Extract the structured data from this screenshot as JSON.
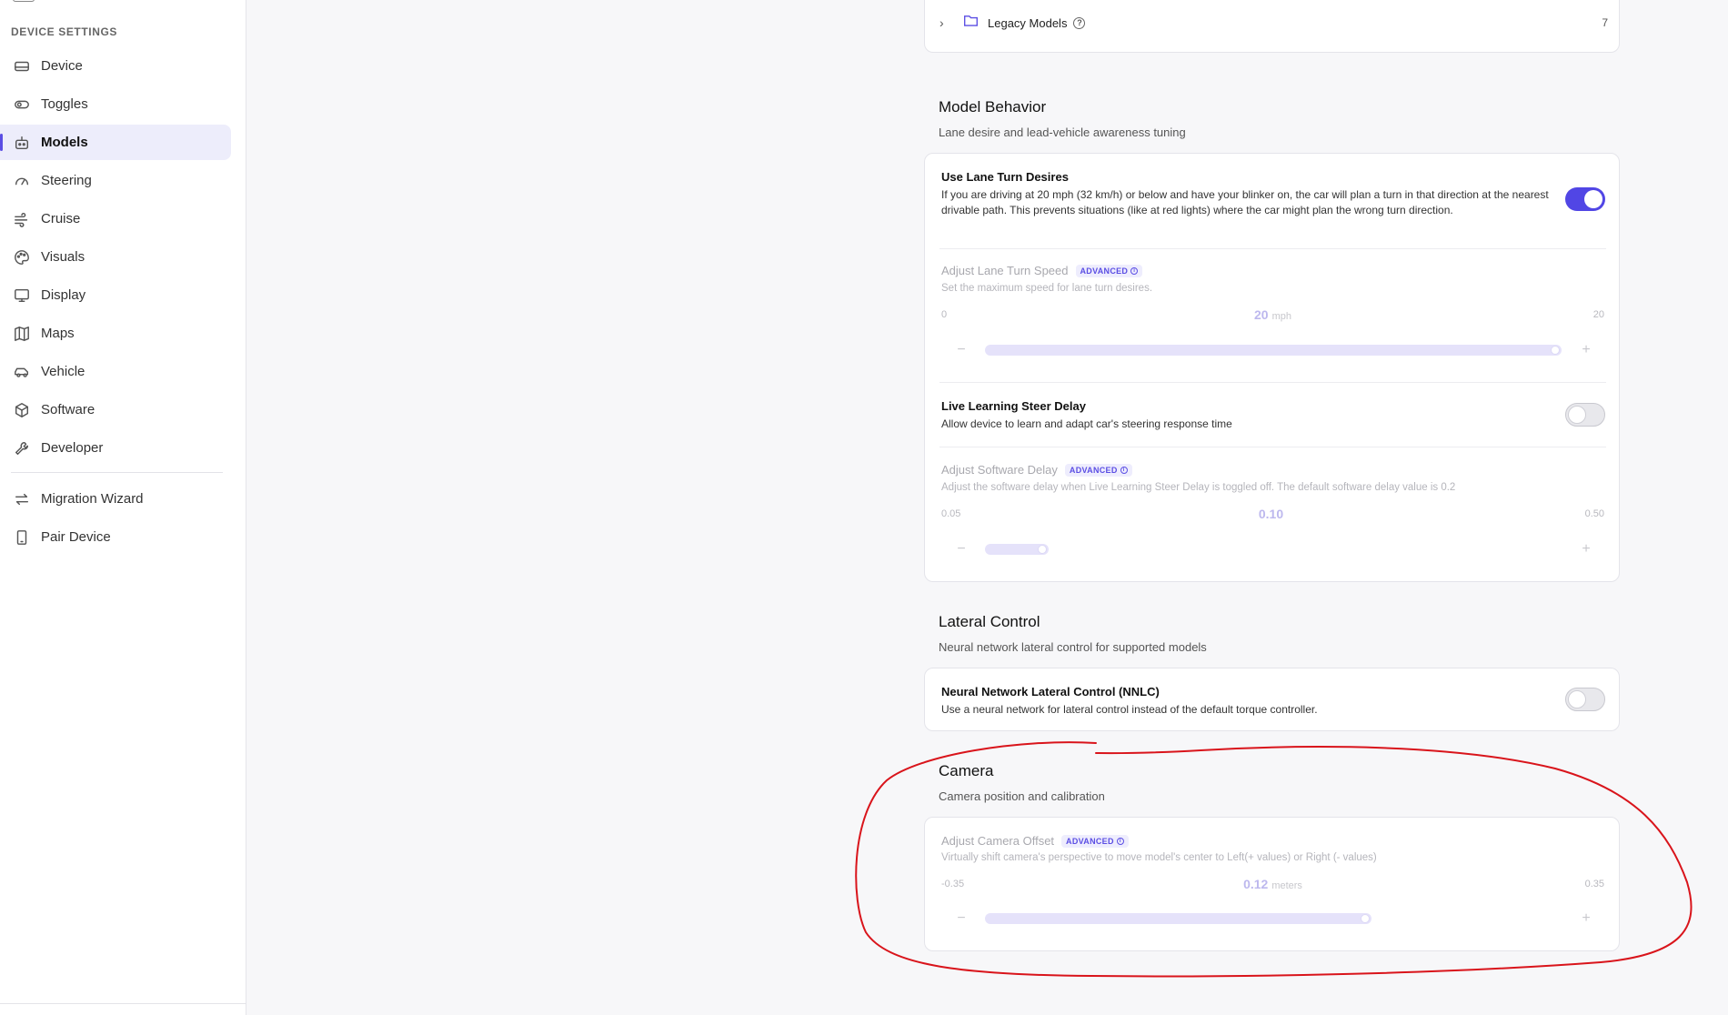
{
  "sidebar": {
    "section_label": "DEVICE SETTINGS",
    "items": [
      {
        "label": "Device",
        "icon": "device-icon"
      },
      {
        "label": "Toggles",
        "icon": "toggle-icon"
      },
      {
        "label": "Models",
        "icon": "robot-icon",
        "active": true
      },
      {
        "label": "Steering",
        "icon": "gauge-icon"
      },
      {
        "label": "Cruise",
        "icon": "wind-icon"
      },
      {
        "label": "Visuals",
        "icon": "palette-icon"
      },
      {
        "label": "Display",
        "icon": "monitor-icon"
      },
      {
        "label": "Maps",
        "icon": "map-icon"
      },
      {
        "label": "Vehicle",
        "icon": "car-icon"
      },
      {
        "label": "Software",
        "icon": "package-icon"
      },
      {
        "label": "Developer",
        "icon": "wrench-icon"
      }
    ],
    "extra_items": [
      {
        "label": "Migration Wizard",
        "icon": "arrows-icon"
      },
      {
        "label": "Pair Device",
        "icon": "tablet-icon"
      }
    ]
  },
  "legacy": {
    "label": "Legacy Models",
    "count": "7"
  },
  "model_behavior": {
    "title": "Model Behavior",
    "subtitle": "Lane desire and lead-vehicle awareness tuning",
    "lane_turn": {
      "title": "Use Lane Turn Desires",
      "desc": "If you are driving at 20 mph (32 km/h) or below and have your blinker on, the car will plan a turn in that direction at the nearest drivable path. This prevents situations (like at red lights) where the car might plan the wrong turn direction.",
      "enabled": true
    },
    "lane_turn_speed": {
      "title": "Adjust Lane Turn Speed",
      "badge": "ADVANCED",
      "desc": "Set the maximum speed for lane turn desires.",
      "min": "0",
      "max": "20",
      "value": "20",
      "unit": "mph",
      "fraction": 1.0,
      "minus": "−",
      "plus": "+"
    },
    "live_learning": {
      "title": "Live Learning Steer Delay",
      "desc": "Allow device to learn and adapt car's steering response time",
      "enabled": false
    },
    "software_delay": {
      "title": "Adjust Software Delay",
      "badge": "ADVANCED",
      "desc": "Adjust the software delay when Live Learning Steer Delay is toggled off. The default software delay value is 0.2",
      "min": "0.05",
      "max": "0.50",
      "value": "0.10",
      "unit": "",
      "fraction": 0.111,
      "minus": "−",
      "plus": "+"
    }
  },
  "lateral_control": {
    "title": "Lateral Control",
    "subtitle": "Neural network lateral control for supported models",
    "nnlc": {
      "title": "Neural Network Lateral Control (NNLC)",
      "desc": "Use a neural network for lateral control instead of the default torque controller.",
      "enabled": false
    }
  },
  "camera": {
    "title": "Camera",
    "subtitle": "Camera position and calibration",
    "offset": {
      "title": "Adjust Camera Offset",
      "badge": "ADVANCED",
      "desc": "Virtually shift camera's perspective to move model's center to Left(+ values) or Right (- values)",
      "min": "-0.35",
      "max": "0.35",
      "value": "0.12",
      "unit": "meters",
      "fraction": 0.671,
      "minus": "−",
      "plus": "+"
    }
  },
  "colors": {
    "accent": "#5146e5",
    "annotation": "#d9141b"
  }
}
